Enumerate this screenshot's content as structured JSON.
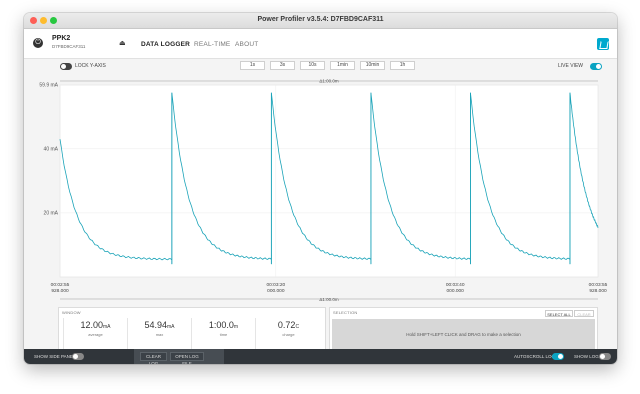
{
  "window": {
    "title": "Power Profiler v3.5.4: D7FBD9CAF311"
  },
  "header": {
    "device_name": "PPK2",
    "device_serial": "D7FBD9CAF311",
    "eject_icon": "eject-icon",
    "nav": [
      {
        "label": "DATA LOGGER",
        "active": true
      },
      {
        "label": "REAL-TIME",
        "active": false
      },
      {
        "label": "ABOUT",
        "active": false
      }
    ]
  },
  "toolbar": {
    "lock_y_axis_label": "LOCK Y-AXIS",
    "lock_y_axis_on": false,
    "window_buttons": [
      "1s",
      "3s",
      "10s",
      "1min",
      "10min",
      "1h"
    ],
    "live_view_label": "LIVE VIEW",
    "live_view_on": true
  },
  "chart_data": {
    "type": "line",
    "top_delta_label": "Δ1:00.0m",
    "bottom_delta_label": "Δ1:00.0m",
    "ylim": [
      0,
      59.9
    ],
    "y_ticks": [
      "59.9 mA",
      "40 mA",
      "20 mA"
    ],
    "y_tick_values": [
      59.9,
      40,
      20
    ],
    "x_ticks": [
      {
        "time": "00:02:55",
        "sub": "928.000"
      },
      {
        "time": "00:03:20",
        "sub": "000.000"
      },
      {
        "time": "00:03:40",
        "sub": "000.000"
      },
      {
        "time": "00:03:55",
        "sub": "928.000"
      }
    ],
    "series": [
      {
        "color": "#1aa3b8",
        "period_s": 11.1,
        "x_range_s": [
          175.928,
          235.928
        ],
        "peak_mA": 57.5,
        "baseline_mA": 5.5,
        "first_peak_mA": 43.0,
        "spike_times_s": [
          188.4,
          199.5,
          210.6,
          221.7,
          232.8
        ]
      }
    ],
    "grid": true
  },
  "window_panel": {
    "title": "WINDOW",
    "stats": [
      {
        "value": "12.00",
        "unit": "mA",
        "label": "average"
      },
      {
        "value": "54.94",
        "unit": "mA",
        "label": "max"
      },
      {
        "value": "1:00.0",
        "unit": "m",
        "label": "time"
      },
      {
        "value": "0.72",
        "unit": "C",
        "label": "charge"
      }
    ]
  },
  "selection_panel": {
    "title": "SELECTION",
    "select_all": "SELECT ALL",
    "clear": "CLEAR",
    "hint": "Hold SHIFT+LEFT CLICK and DRAG to make a selection"
  },
  "bottom_bar": {
    "show_side_panel": "SHOW SIDE PANEL",
    "clear_log": "CLEAR LOG",
    "open_log_file": "OPEN LOG FILE",
    "autoscroll_log": "AUTOSCROLL LOG",
    "autoscroll_on": true,
    "show_log": "SHOW LOG",
    "show_log_on": false
  }
}
